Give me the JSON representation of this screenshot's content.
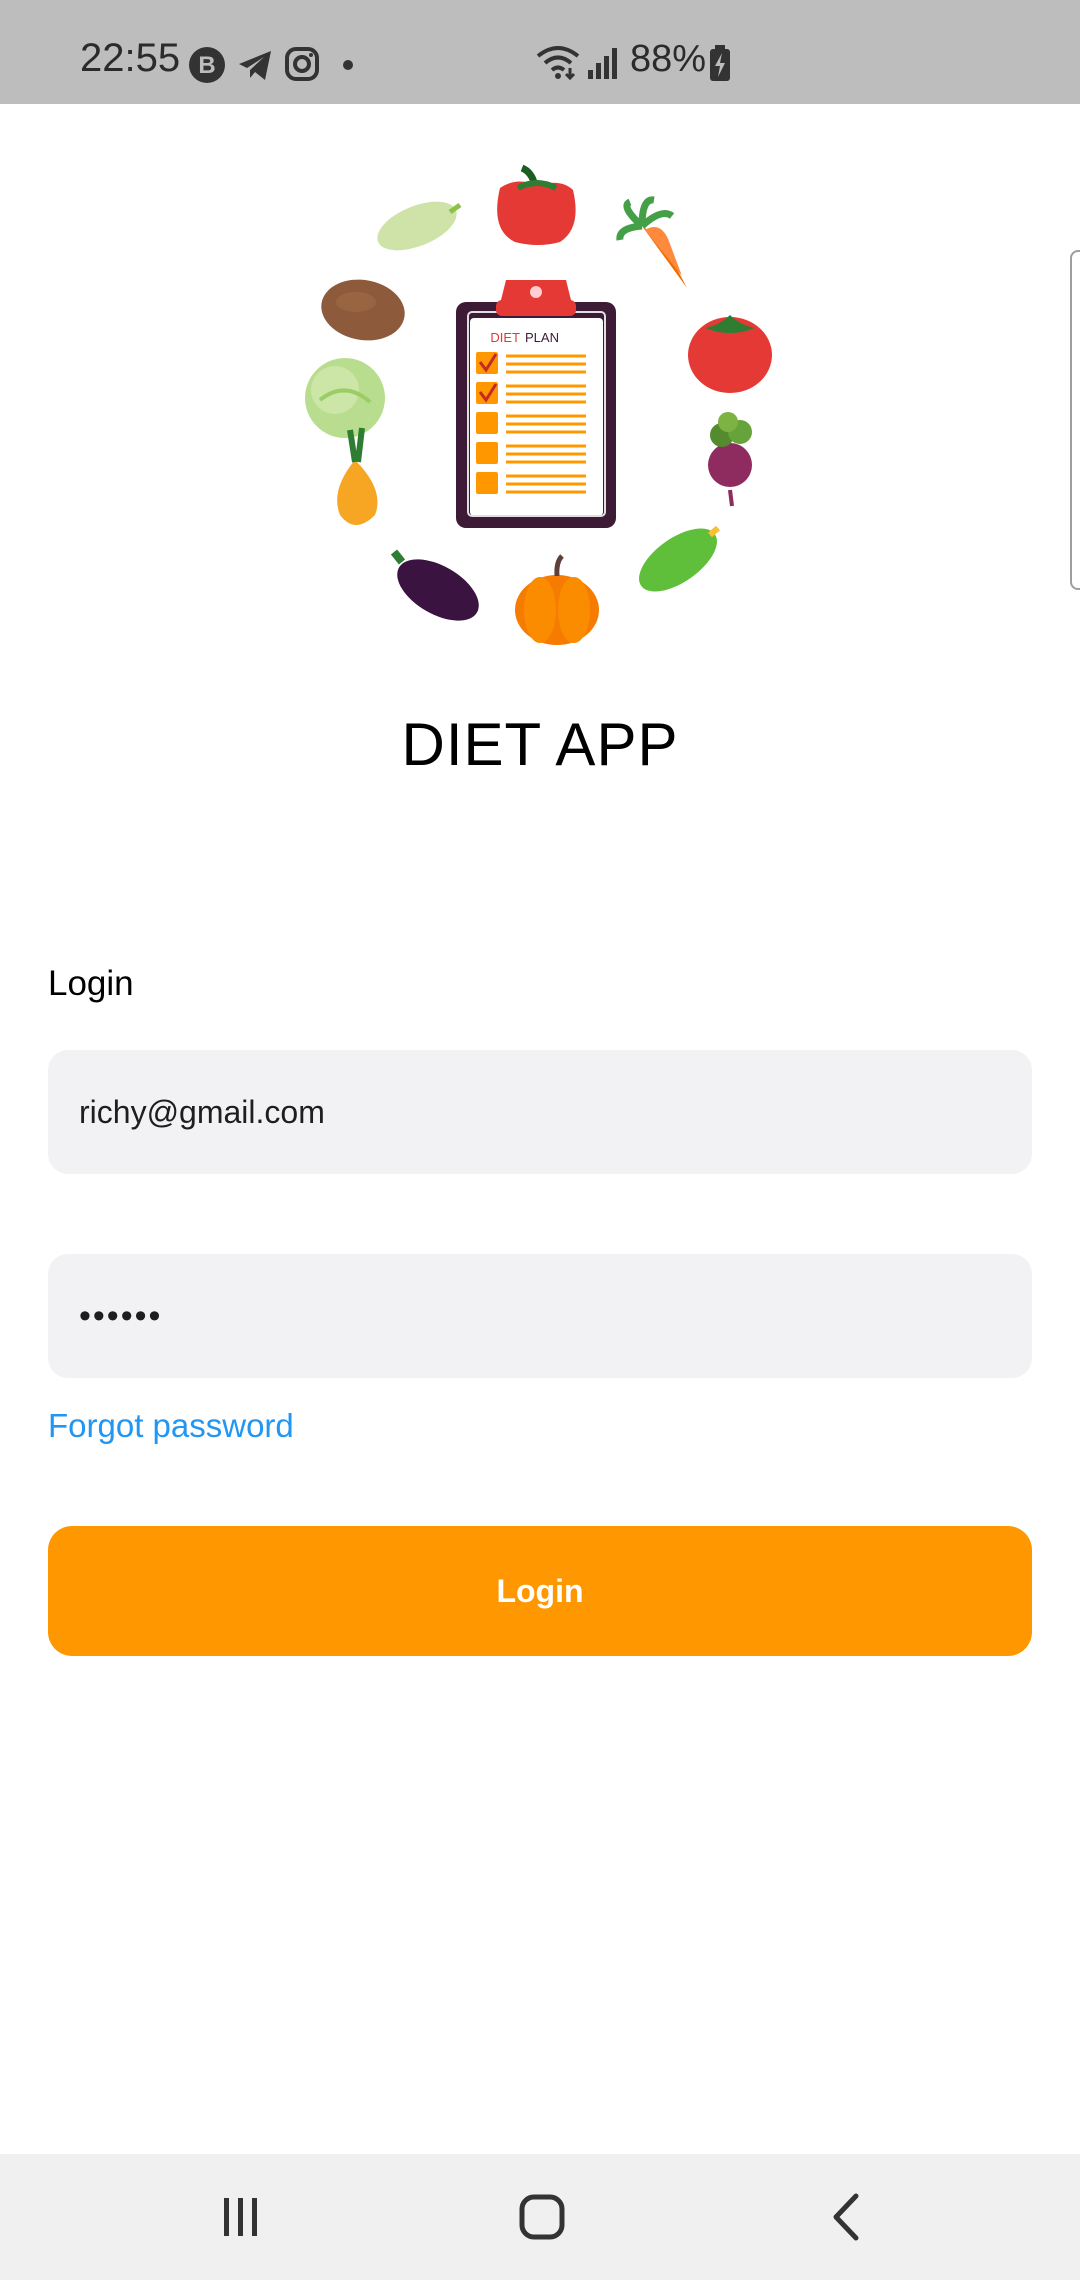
{
  "status_bar": {
    "time": "22:55",
    "notification_icons": [
      "b-badge-icon",
      "telegram-icon",
      "instagram-icon",
      "dot-icon"
    ],
    "system_icons": [
      "wifi-icon",
      "signal-icon"
    ],
    "battery": "88%"
  },
  "illustration": {
    "clipboard_title_red": "DIET",
    "clipboard_title_dark": "PLAN"
  },
  "app": {
    "title": "DIET APP"
  },
  "form": {
    "section_label": "Login",
    "email_value": "richy@gmail.com",
    "password_value": "••••••",
    "forgot_label": "Forgot password",
    "submit_label": "Login"
  },
  "colors": {
    "accent": "#ff9800",
    "link": "#2196f3",
    "field_bg": "#f2f2f4",
    "status_bar_bg": "#bdbdbd",
    "nav_bar_bg": "#f0f0f0"
  },
  "nav_bar": {
    "buttons": [
      "recent-apps-icon",
      "home-icon",
      "back-icon"
    ]
  }
}
